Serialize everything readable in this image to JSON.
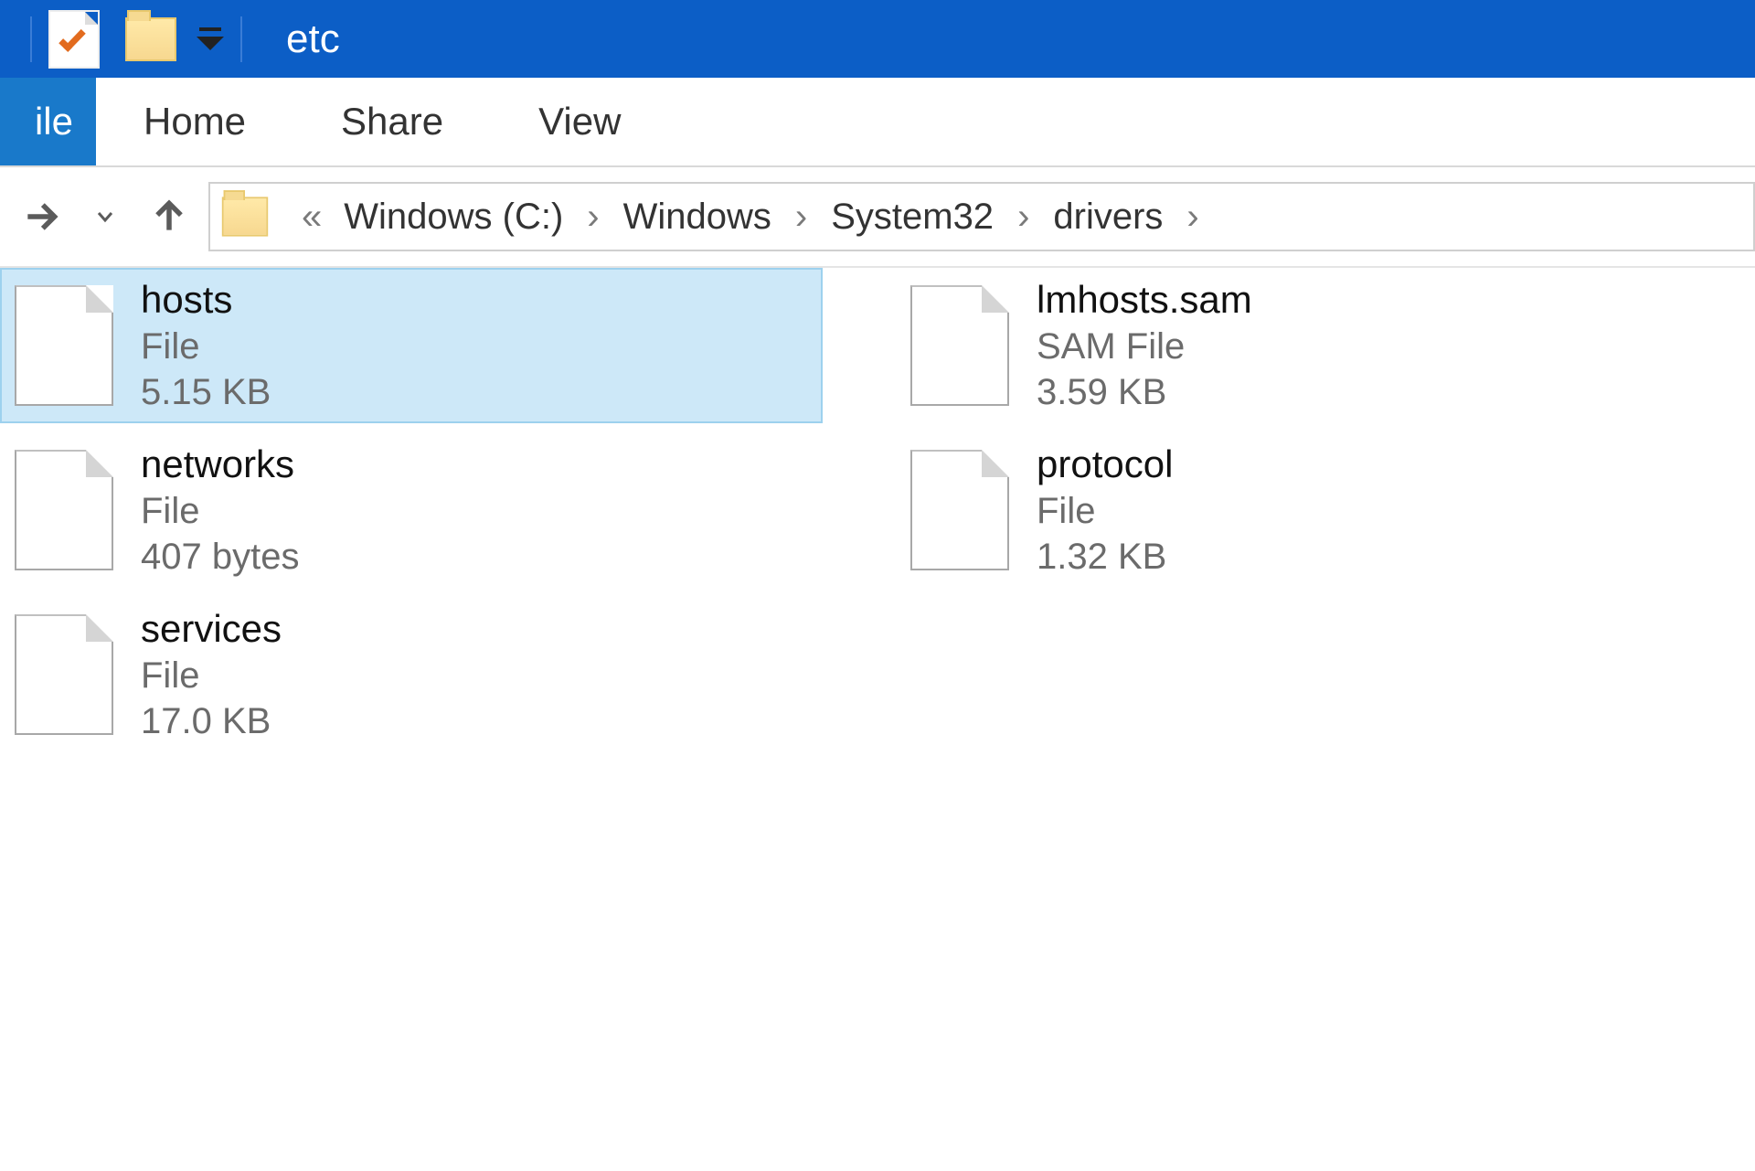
{
  "window": {
    "title": "etc"
  },
  "ribbon": {
    "tabs": [
      {
        "id": "file",
        "label": "ile"
      },
      {
        "id": "home",
        "label": "Home"
      },
      {
        "id": "share",
        "label": "Share"
      },
      {
        "id": "view",
        "label": "View"
      }
    ]
  },
  "breadcrumb": {
    "segments": [
      {
        "label": "Windows (C:)"
      },
      {
        "label": "Windows"
      },
      {
        "label": "System32"
      },
      {
        "label": "drivers"
      }
    ]
  },
  "files": [
    {
      "name": "hosts",
      "type": "File",
      "size": "5.15 KB",
      "selected": true
    },
    {
      "name": "networks",
      "type": "File",
      "size": "407 bytes",
      "selected": false
    },
    {
      "name": "services",
      "type": "File",
      "size": "17.0 KB",
      "selected": false
    },
    {
      "name": "lmhosts.sam",
      "type": "SAM File",
      "size": "3.59 KB",
      "selected": false
    },
    {
      "name": "protocol",
      "type": "File",
      "size": "1.32 KB",
      "selected": false
    }
  ]
}
